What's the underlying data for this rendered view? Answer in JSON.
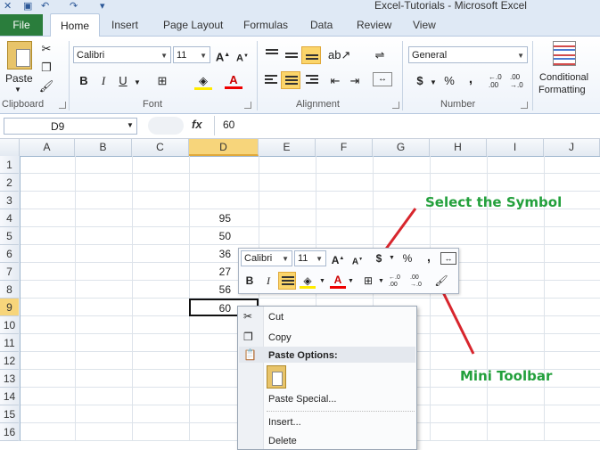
{
  "window": {
    "title": "Excel-Tutorials  -  Microsoft Excel"
  },
  "ribbon_tabs": {
    "file": "File",
    "home": "Home",
    "insert": "Insert",
    "page_layout": "Page Layout",
    "formulas": "Formulas",
    "data": "Data",
    "review": "Review",
    "view": "View"
  },
  "ribbon": {
    "clipboard": {
      "paste": "Paste",
      "label": "Clipboard"
    },
    "font": {
      "name": "Calibri",
      "size": "11",
      "bold": "B",
      "italic": "I",
      "underline": "U",
      "label": "Font"
    },
    "alignment": {
      "label": "Alignment"
    },
    "number": {
      "format": "General",
      "currency": "$",
      "percent": "%",
      "comma": ",",
      "label": "Number",
      "inc_dec": ".0 .00"
    },
    "styles": {
      "conditional_1": "Conditional",
      "conditional_2": "Formatting"
    }
  },
  "formula_bar": {
    "name_box": "D9",
    "fx": "fx",
    "value": "60"
  },
  "columns": [
    "A",
    "B",
    "C",
    "D",
    "E",
    "F",
    "G",
    "H",
    "I",
    "J"
  ],
  "rows": [
    "1",
    "2",
    "3",
    "4",
    "5",
    "6",
    "7",
    "8",
    "9",
    "10",
    "11",
    "12",
    "13",
    "14",
    "15",
    "16"
  ],
  "cells_d": [
    "95",
    "50",
    "36",
    "27",
    "56",
    "60"
  ],
  "mini_toolbar": {
    "font": "Calibri",
    "size": "11",
    "currency": "$",
    "percent": "%",
    "comma": ",",
    "bold": "B",
    "italic": "I"
  },
  "context_menu": {
    "cut": "Cut",
    "copy": "Copy",
    "paste_options": "Paste Options:",
    "paste_special": "Paste Special...",
    "insert": "Insert...",
    "delete": "Delete"
  },
  "annotations": {
    "select_symbol": "Select the Symbol",
    "mini_toolbar": "Mini Toolbar"
  },
  "colors": {
    "file_tab": "#2a7d3c",
    "highlight": "#fbd56a",
    "annotation_text": "#23a03c",
    "arrow": "#d8262d"
  }
}
